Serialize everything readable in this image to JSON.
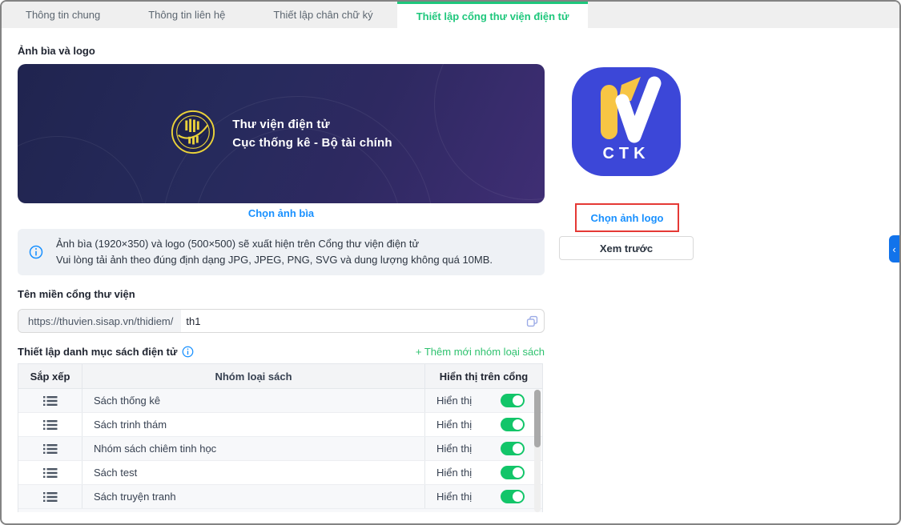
{
  "tabs": [
    {
      "label": "Thông tin chung",
      "active": false
    },
    {
      "label": "Thông tin liên hệ",
      "active": false
    },
    {
      "label": "Thiết lập chân chữ ký",
      "active": false
    },
    {
      "label": "Thiết lập cổng thư viện điện tử",
      "active": true
    }
  ],
  "cover_section": {
    "title": "Ảnh bìa và logo",
    "banner": {
      "line1": "Thư viện điện tử",
      "line2": "Cục thống kê - Bộ tài chính"
    },
    "choose_cover_label": "Chọn ảnh bìa",
    "info_line1": "Ảnh bìa (1920×350) và logo (500×500) sẽ xuất hiện trên Cổng thư viện điện tử",
    "info_line2": "Vui lòng tải ảnh theo đúng định dạng JPG, JPEG, PNG, SVG và dung lượng không quá 10MB."
  },
  "domain_section": {
    "label": "Tên miền cổng thư viện",
    "url_prefix": "https://thuvien.sisap.vn/thidiem/",
    "value": "th1"
  },
  "catalog_section": {
    "title": "Thiết lập danh mục sách điện tử",
    "add_link": "+ Thêm mới nhóm loại sách",
    "columns": [
      "Sắp xếp",
      "Nhóm loại sách",
      "Hiển thị trên cổng"
    ],
    "visible_label": "Hiển thị",
    "rows": [
      {
        "name": "Sách thống kê",
        "visible": true
      },
      {
        "name": "Sách trinh thám",
        "visible": true
      },
      {
        "name": "Nhóm sách chiêm tinh học",
        "visible": true
      },
      {
        "name": "Sách test",
        "visible": true
      },
      {
        "name": "Sách truyện tranh",
        "visible": true
      }
    ]
  },
  "logo_section": {
    "logo_letters": "CTK",
    "choose_logo_label": "Chọn ảnh logo",
    "preview_label": "Xem trước"
  },
  "colors": {
    "accent_green": "#1ec77c",
    "toggle_green": "#12c569",
    "link_blue": "#1890ff",
    "logo_blue": "#3c47d8",
    "logo_yellow": "#f7c544",
    "banner_navy": "#262a5c",
    "highlight_red": "#e53935"
  }
}
